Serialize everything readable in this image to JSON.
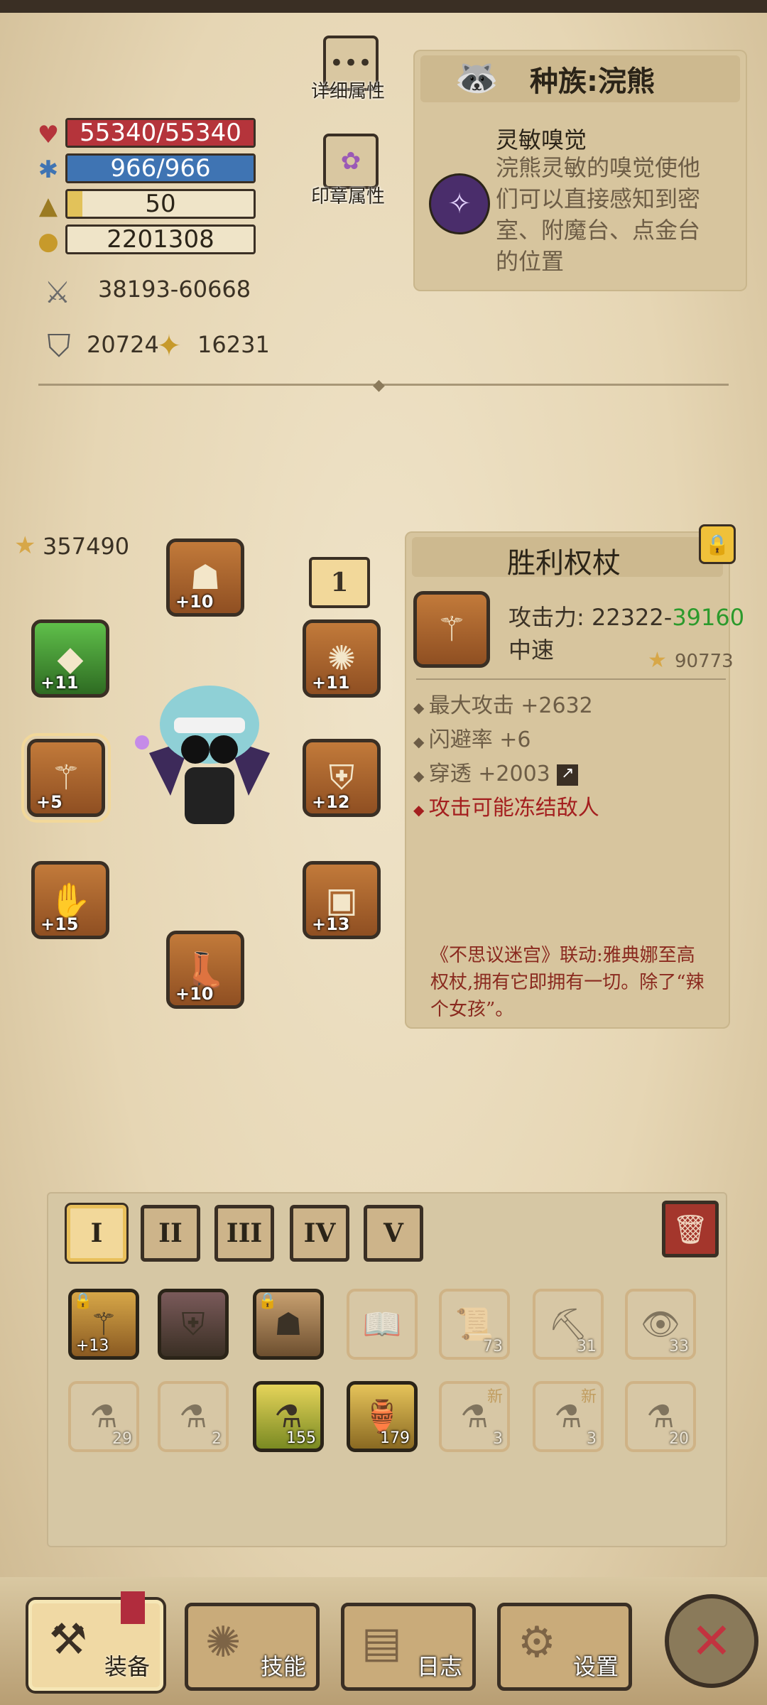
{
  "stats": {
    "hp": "55340/55340",
    "hp_fill": 1.0,
    "mp": "966/966",
    "mp_fill": 1.0,
    "level": "50",
    "level_fill": 0.08,
    "gold": "2201308",
    "attack": "38193-60668",
    "defense": "20724",
    "magic": "16231"
  },
  "side_buttons": {
    "details": "详细属性",
    "seal": "印章属性"
  },
  "race": {
    "title": "种族:浣熊",
    "trait_name": "灵敏嗅觉",
    "trait_desc": "浣熊灵敏的嗅觉使他们可以直接感知到密室、附魔台、点金台的位置"
  },
  "equipment": {
    "score": "357490",
    "floor_badge": "1",
    "slots": [
      {
        "name": "helmet",
        "plus": "+10",
        "icon": "helmet-icon"
      },
      {
        "name": "left-trinket",
        "plus": "+11",
        "icon": "gem-icon"
      },
      {
        "name": "weapon",
        "plus": "+5",
        "icon": "scepter-icon"
      },
      {
        "name": "gloves",
        "plus": "+15",
        "icon": "glove-icon"
      },
      {
        "name": "boots",
        "plus": "+10",
        "icon": "boots-icon"
      },
      {
        "name": "amulet",
        "plus": "+11",
        "icon": "amulet-icon"
      },
      {
        "name": "armor",
        "plus": "+12",
        "icon": "armor-icon"
      },
      {
        "name": "belt",
        "plus": "+13",
        "icon": "belt-icon"
      }
    ]
  },
  "item": {
    "name": "胜利权杖",
    "attack_label": "攻击力: 22322-",
    "attack_high": "39160",
    "speed": "中速",
    "score": "90773",
    "bonuses": [
      "最大攻击 +2632",
      "闪避率 +6",
      "穿透 +2003"
    ],
    "special": "攻击可能冻结敌人",
    "flavor": "《不思议迷宫》联动:雅典娜至高权杖,拥有它即拥有一切。除了“辣个女孩”。"
  },
  "inventory": {
    "tabs": [
      "I",
      "II",
      "III",
      "IV",
      "V"
    ],
    "row1": [
      {
        "icon": "staff-icon",
        "count": "+13",
        "on": true,
        "locked": true
      },
      {
        "icon": "dark-armor-icon",
        "count": "",
        "on": true,
        "locked": false
      },
      {
        "icon": "winged-helm-icon",
        "count": "",
        "on": true,
        "locked": true
      },
      {
        "icon": "book-icon",
        "count": "",
        "on": false,
        "locked": false
      },
      {
        "icon": "scroll-icon",
        "count": "73",
        "on": false,
        "locked": false
      },
      {
        "icon": "pickaxe-icon",
        "count": "31",
        "on": false,
        "locked": false
      },
      {
        "icon": "map-icon",
        "count": "33",
        "on": false,
        "locked": false
      }
    ],
    "row2": [
      {
        "icon": "potion-green-icon",
        "count": "29",
        "on": false,
        "new": false
      },
      {
        "icon": "potion-red-icon",
        "count": "2",
        "on": false,
        "new": false
      },
      {
        "icon": "elixir-icon",
        "count": "155",
        "on": true,
        "new": false
      },
      {
        "icon": "golden-flask-icon",
        "count": "179",
        "on": true,
        "new": false
      },
      {
        "icon": "potion-blue-icon",
        "count": "3",
        "on": false,
        "new": true
      },
      {
        "icon": "potion-pink-icon",
        "count": "3",
        "on": false,
        "new": true
      },
      {
        "icon": "potion-orange-icon",
        "count": "20",
        "on": false,
        "new": false
      }
    ],
    "new_label": "新"
  },
  "bottom_nav": {
    "equip": "装备",
    "skills": "技能",
    "log": "日志",
    "settings": "设置"
  },
  "colors": {
    "hp": "#b5343b",
    "mp": "#3f74b3",
    "xp": "#e2c25a",
    "special": "#a41f1f",
    "attack_high": "#2c9a2c"
  }
}
